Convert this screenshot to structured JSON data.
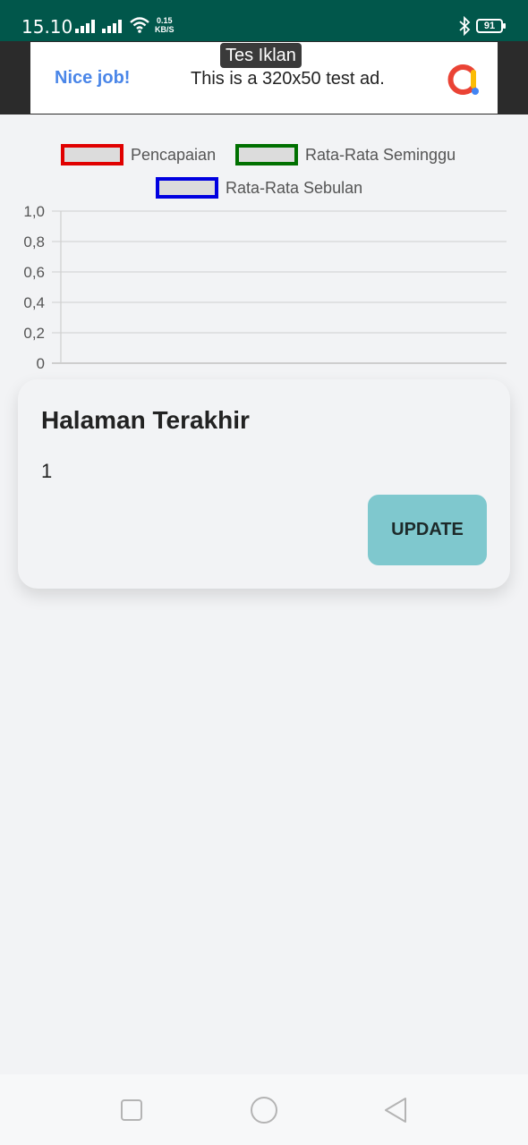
{
  "status": {
    "time": "15.10",
    "net_speed_value": "0.15",
    "net_speed_unit": "KB/S",
    "battery": "91"
  },
  "ad": {
    "tag": "Tes Iklan",
    "nice": "Nice job!",
    "text": "This is a 320x50 test ad."
  },
  "legend": [
    {
      "label": "Pencapaian",
      "color": "#e00000"
    },
    {
      "label": "Rata-Rata Seminggu",
      "color": "#007000"
    },
    {
      "label": "Rata-Rata Sebulan",
      "color": "#0000e0"
    }
  ],
  "chart_data": {
    "type": "line",
    "title": "",
    "xlabel": "",
    "ylabel": "",
    "series": [
      {
        "name": "Pencapaian",
        "values": []
      },
      {
        "name": "Rata-Rata Seminggu",
        "values": []
      },
      {
        "name": "Rata-Rata Sebulan",
        "values": []
      }
    ],
    "ylim": [
      0,
      1
    ],
    "y_ticks": [
      "0",
      "0,2",
      "0,4",
      "0,6",
      "0,8",
      "1,0"
    ],
    "grid": true,
    "legend_position": "top"
  },
  "card": {
    "title": "Halaman Terakhir",
    "value": "1",
    "button": "UPDATE"
  },
  "nav": {
    "icons": [
      "recents-icon",
      "home-icon",
      "back-icon"
    ]
  }
}
